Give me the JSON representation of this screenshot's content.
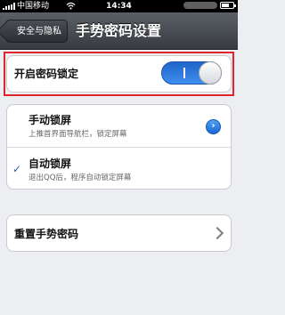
{
  "status_bar": {
    "carrier": "中国移动",
    "time": "14:34"
  },
  "nav": {
    "back_label": "安全与隐私",
    "title": "手势密码设置"
  },
  "password_lock": {
    "label": "开启密码锁定",
    "enabled": true
  },
  "lock_options": [
    {
      "title": "手动锁屏",
      "subtitle": "上推首界面导航栏，锁定屏幕",
      "selected": false
    },
    {
      "title": "自动锁屏",
      "subtitle": "退出QQ后，程序自动锁定屏幕",
      "selected": true
    }
  ],
  "reset": {
    "label": "重置手势密码"
  },
  "colors": {
    "accent": "#2f7fe6",
    "highlight_border": "#e0242b"
  }
}
